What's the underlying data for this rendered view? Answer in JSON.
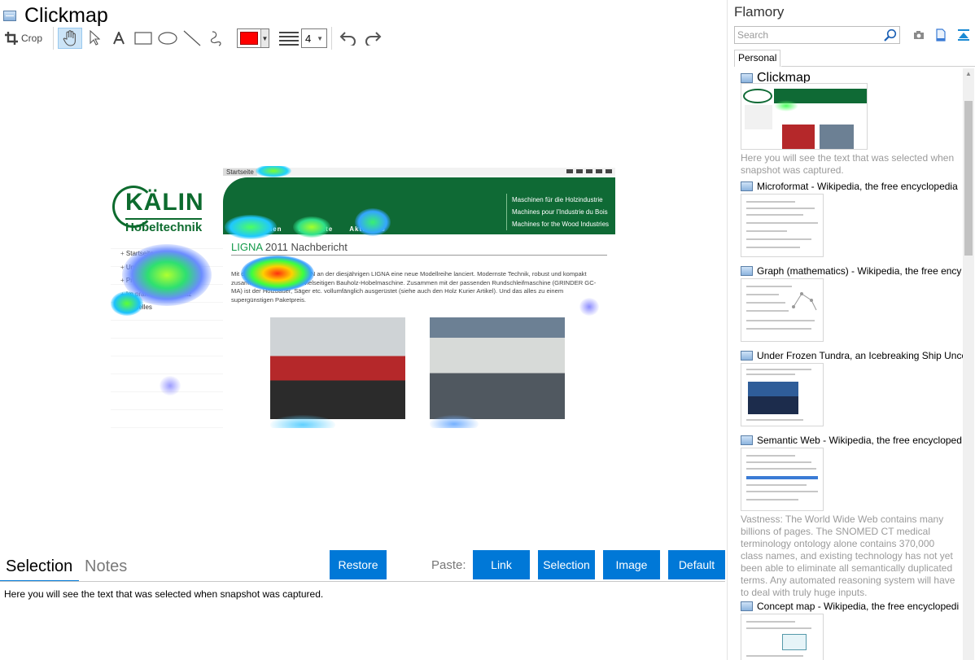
{
  "window": {
    "title": "Clickmap"
  },
  "toolbar": {
    "crop_label": "Crop",
    "line_width": "4"
  },
  "colors": {
    "accent": "#0078d7",
    "pen": "#ff0000",
    "site_green": "#0f6a35"
  },
  "capture": {
    "nav_top": [
      "Startseite",
      "Kontakt"
    ],
    "logo_name": "KÄLIN",
    "logo_sub": "Hobeltechnik",
    "taglines": [
      "Maschinen für die Holzindustrie",
      "Machines pour l'Industrie du Bois",
      "Machines for the Wood Industries"
    ],
    "banner_nav": [
      "Unternehmen",
      "Produkte",
      "Aktuelles"
    ],
    "sidebar": [
      "Startseite",
      "Unternehmen",
      "Produkte",
      "Im praktischen Einsatz",
      "Aktuelles"
    ],
    "heading_a": "LIGNA",
    "heading_b": " 2011 Nachbericht",
    "body": "Mit der NEW YORK hat KÄLIN an der diesjährigen LIGNA eine neue Modellreihe lanciert. Modernste Technik, robust und kompakt zusammengefügt zu einer vielseitigen Bauholz-Hobelmaschine. Zusammen mit der passenden Rundschleifmaschine (GRINDER GC-MA) ist der Holzbauer, Säger etc. vollumfänglich ausgerüstet (siehe auch den Holz Kurier Artikel). Und das alles zu einem supergünstigen Paketpreis."
  },
  "bottom": {
    "tabs": [
      "Selection",
      "Notes"
    ],
    "restore": "Restore",
    "paste_label": "Paste:",
    "paste_buttons": [
      "Link",
      "Selection",
      "Image",
      "Default"
    ],
    "selection_text": "Here you will see the text that was selected when snapshot was captured."
  },
  "sidebar": {
    "title": "Flamory",
    "search_placeholder": "Search",
    "tab": "Personal",
    "entries": [
      {
        "title": "Clickmap",
        "desc": "Here you will see the text that was selected when snapshot was captured."
      },
      {
        "title": "Microformat - Wikipedia, the free encyclopedia",
        "desc": ""
      },
      {
        "title": "Graph (mathematics) - Wikipedia, the free ency",
        "desc": ""
      },
      {
        "title": "Under Frozen Tundra, an Icebreaking Ship Unco",
        "desc": ""
      },
      {
        "title": "Semantic Web - Wikipedia, the free encycloped",
        "desc": "Vastness: The World Wide Web contains many billions of pages. The SNOMED CT medical terminology ontology alone contains 370,000 class names, and existing technology has not yet been able to eliminate all semantically duplicated terms. Any automated reasoning system will have to deal with truly huge inputs."
      },
      {
        "title": "Concept map - Wikipedia, the free encyclopedi",
        "desc": ""
      }
    ]
  }
}
